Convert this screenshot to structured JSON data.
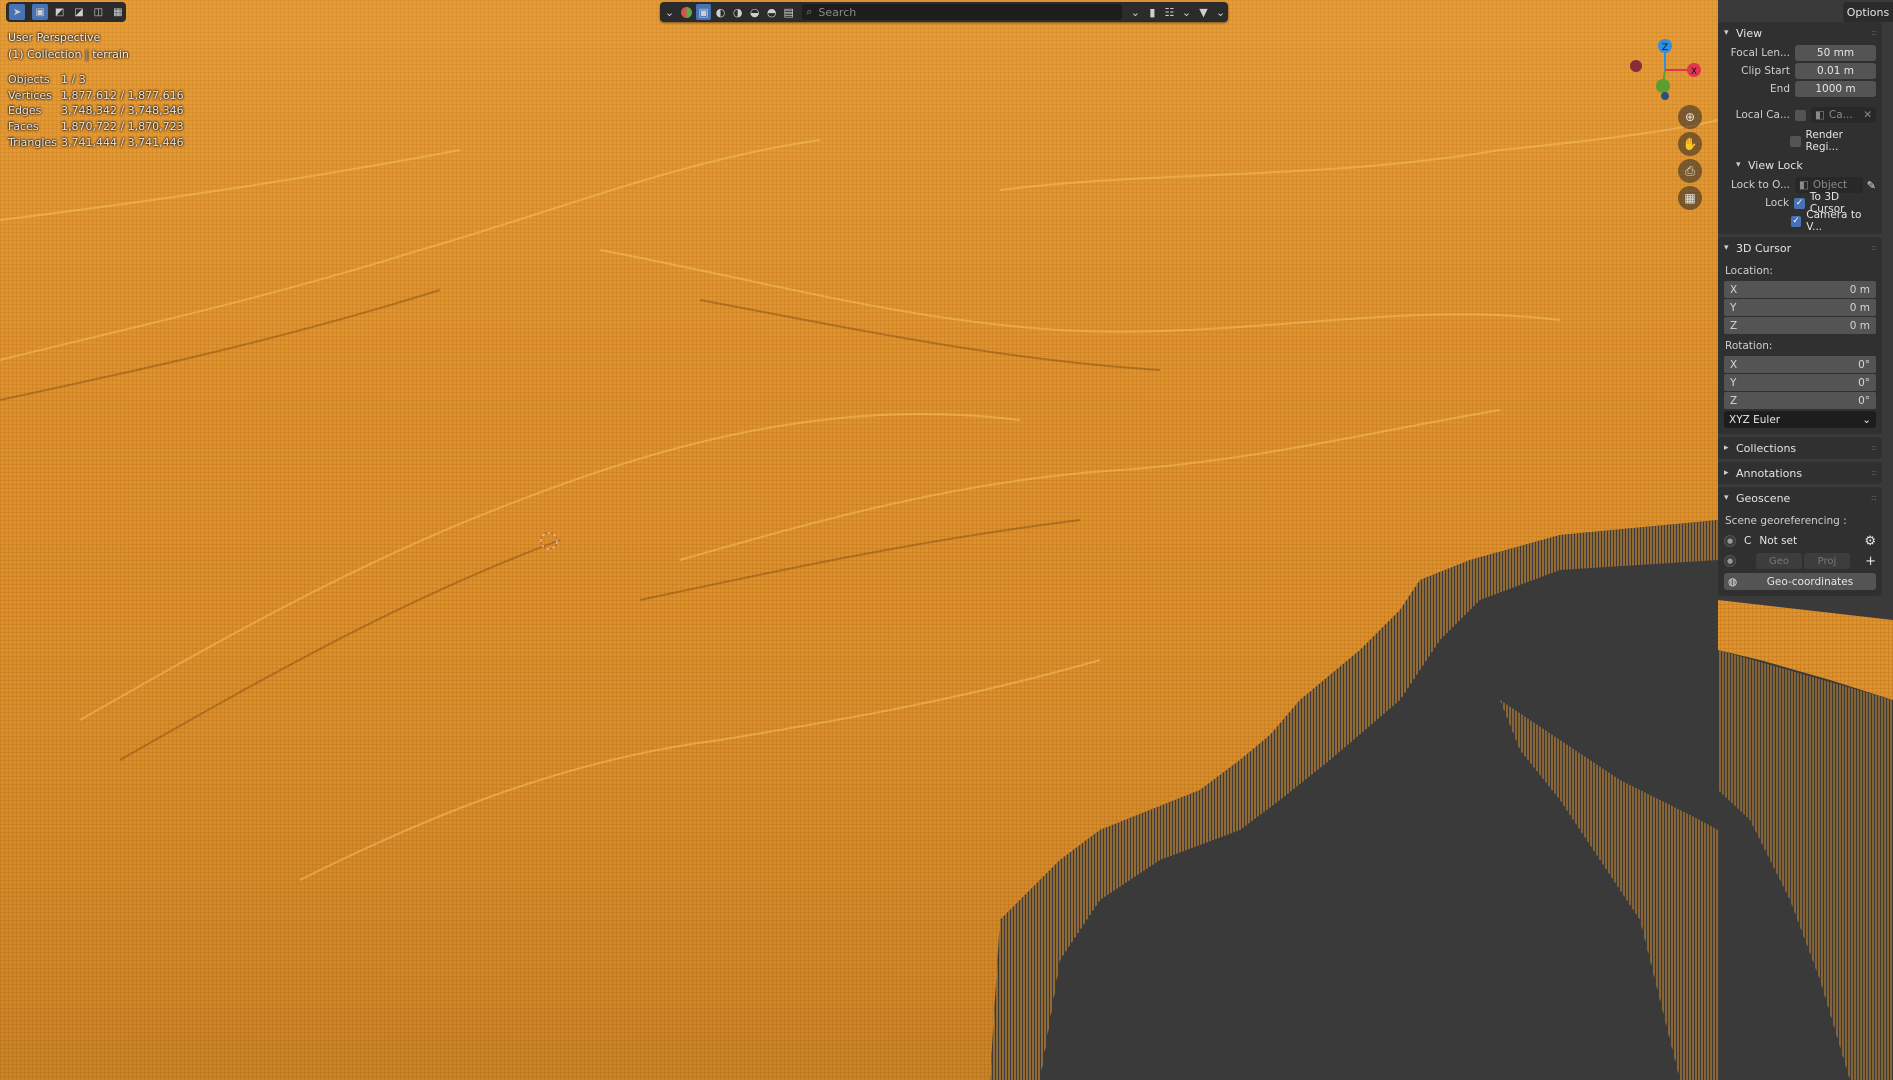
{
  "viewport": {
    "perspective_label": "User Perspective",
    "collection_label": "(1) Collection",
    "object_label": "terrain",
    "stats": [
      {
        "key": "Objects",
        "value": "1 / 3"
      },
      {
        "key": "Vertices",
        "value": "1,877,612 / 1,877,616"
      },
      {
        "key": "Edges",
        "value": "3,748,342 / 3,748,346"
      },
      {
        "key": "Faces",
        "value": "1,870,722 / 1,870,723"
      },
      {
        "key": "Triangles",
        "value": "3,741,444 / 3,741,446"
      }
    ],
    "wire_color": "#f0a030",
    "background_color": "#3a3a3a"
  },
  "toolbar": {
    "search_placeholder": "Search",
    "options_label": "Options"
  },
  "gizmo": {
    "z_label": "Z",
    "x_label": "X",
    "x_color": "#e0364f",
    "y_color": "#5c9e34",
    "z_color": "#2e8fe0"
  },
  "sidebar": {
    "view": {
      "title": "View",
      "focal_length_label": "Focal Len...",
      "focal_length_value": "50 mm",
      "clip_start_label": "Clip Start",
      "clip_start_value": "0.01 m",
      "end_label": "End",
      "end_value": "1000 m",
      "local_camera_label": "Local Ca...",
      "local_camera_value": "Ca...",
      "render_region_label": "Render Regi...",
      "view_lock_title": "View Lock",
      "lock_to_object_label": "Lock to O...",
      "lock_to_object_placeholder": "Object",
      "lock_label": "Lock",
      "to_3d_cursor_label": "To 3D Cursor",
      "camera_to_view_label": "Camera to V..."
    },
    "cursor": {
      "title": "3D Cursor",
      "location_label": "Location:",
      "loc_x_label": "X",
      "loc_x": "0 m",
      "loc_y_label": "Y",
      "loc_y": "0 m",
      "loc_z_label": "Z",
      "loc_z": "0 m",
      "rotation_label": "Rotation:",
      "rot_x_label": "X",
      "rot_x": "0°",
      "rot_y_label": "Y",
      "rot_y": "0°",
      "rot_z_label": "Z",
      "rot_z": "0°",
      "rotation_mode": "XYZ Euler"
    },
    "collections_title": "Collections",
    "annotations_title": "Annotations",
    "geoscene": {
      "title": "Geoscene",
      "georef_label": "Scene georeferencing :",
      "crs_letter": "C",
      "crs_value": "Not set",
      "geo_label": "Geo",
      "proj_label": "Proj",
      "geocoords_label": "Geo-coordinates"
    }
  }
}
